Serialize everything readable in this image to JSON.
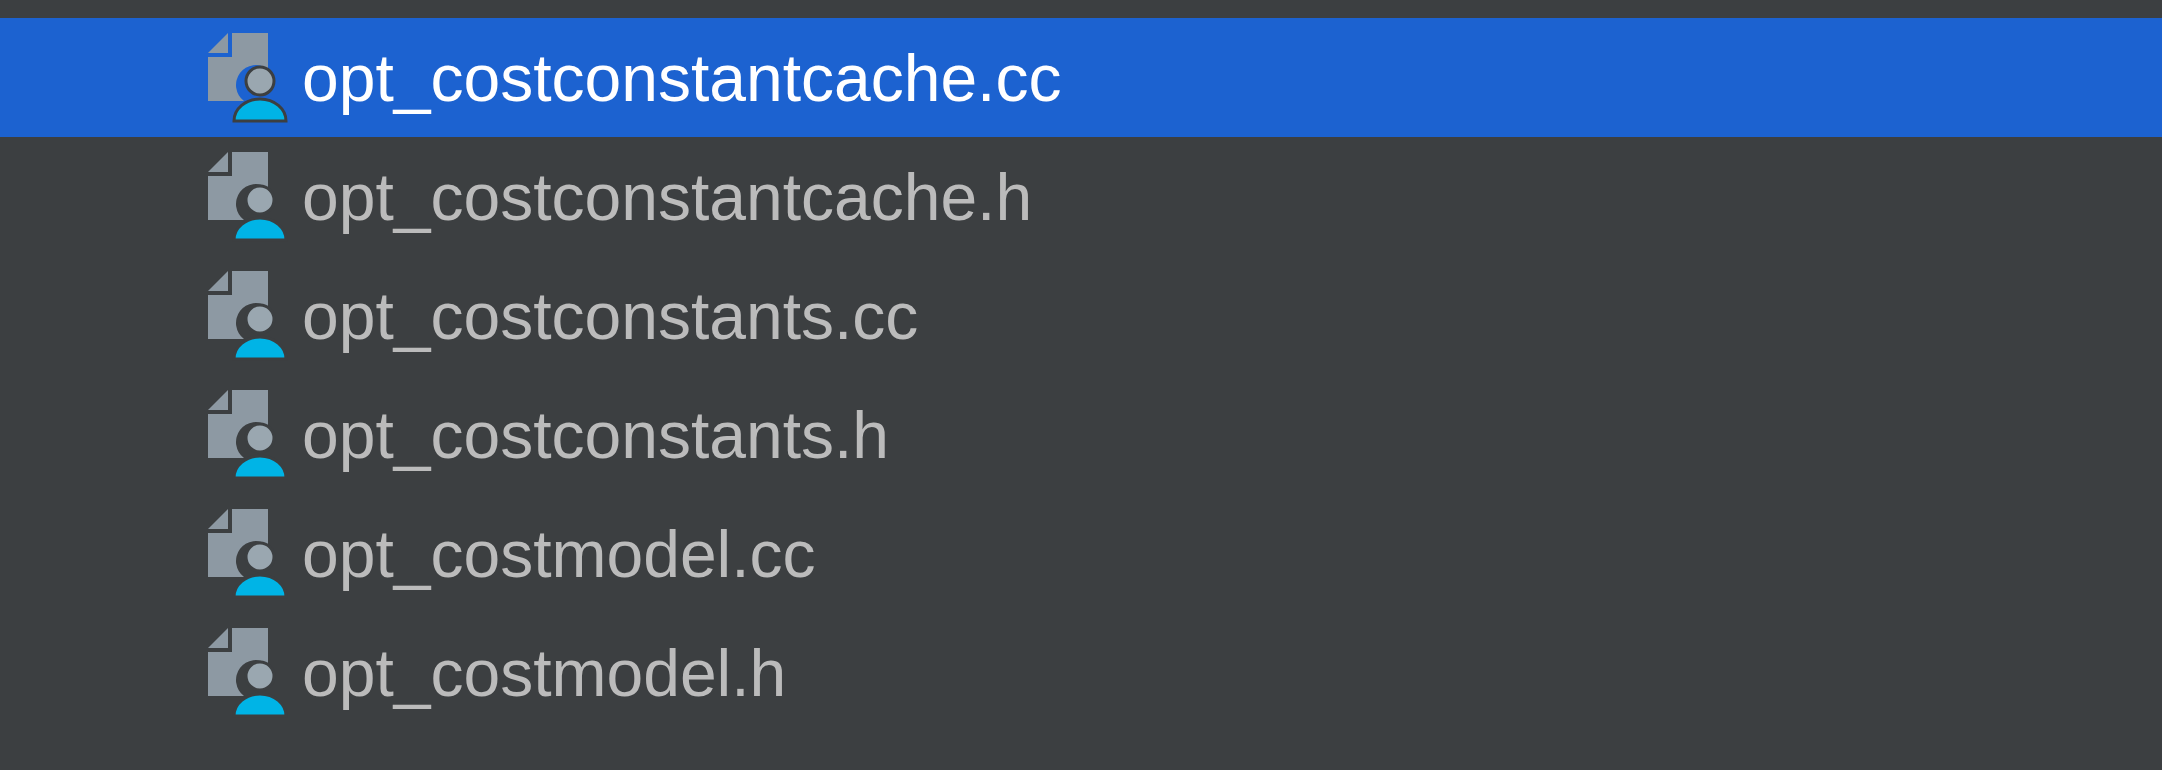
{
  "files": [
    {
      "name": "opt_costconstantcache.cc",
      "selected": true
    },
    {
      "name": "opt_costconstantcache.h",
      "selected": false
    },
    {
      "name": "opt_costconstants.cc",
      "selected": false
    },
    {
      "name": "opt_costconstants.h",
      "selected": false
    },
    {
      "name": "opt_costmodel.cc",
      "selected": false
    },
    {
      "name": "opt_costmodel.h",
      "selected": false
    }
  ]
}
